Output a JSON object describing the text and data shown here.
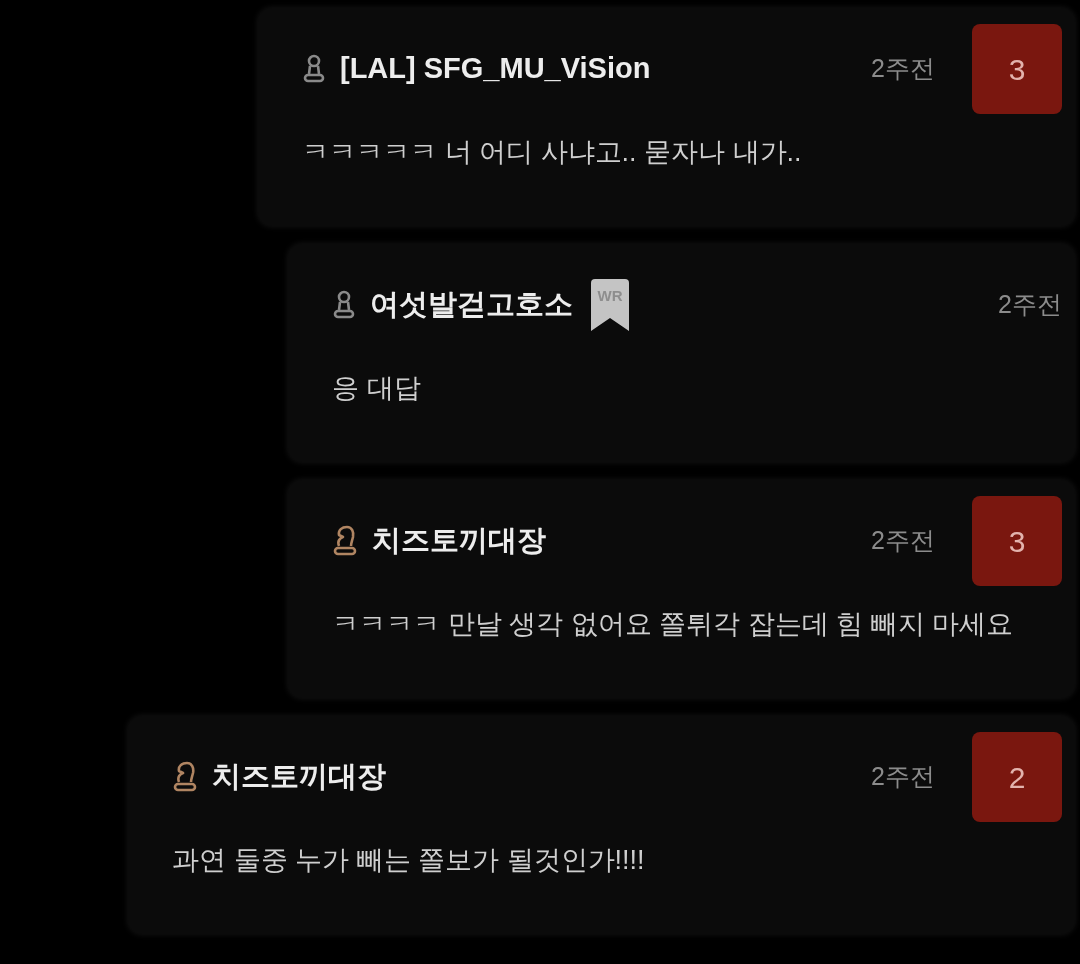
{
  "replies": [
    {
      "kind": "pawn",
      "author": "[LAL] SFG_MU_ViSion",
      "time": "2주전",
      "votes": "3",
      "text": "ㅋㅋㅋㅋㅋ 너 어디 사냐고.. 묻자나 내가..",
      "children": [
        {
          "kind": "pawn",
          "author": "여섯발걷고호소",
          "writer_badge": "WR",
          "time": "2주전",
          "text": "응 대답"
        },
        {
          "kind": "knight",
          "author": "치즈토끼대장",
          "time": "2주전",
          "votes": "3",
          "text": "ㅋㅋㅋㅋ 만날 생각 없어요 쫄튀각 잡는데 힘 빼지 마세요"
        }
      ]
    }
  ],
  "comments": [
    {
      "kind": "knight",
      "author": "치즈토끼대장",
      "time": "2주전",
      "votes": "2",
      "text": "과연 둘중 누가 빼는 쫄보가 될것인가!!!!"
    }
  ]
}
